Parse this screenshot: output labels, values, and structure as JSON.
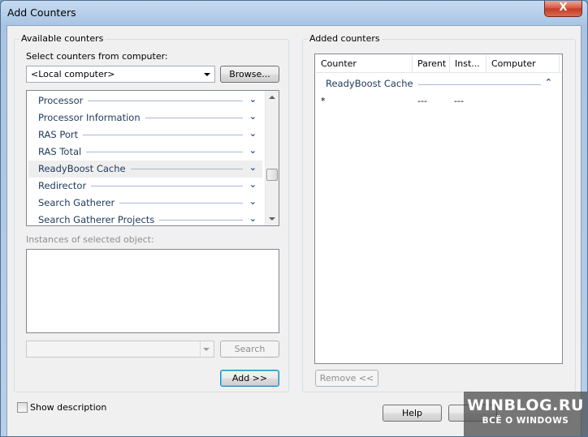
{
  "window": {
    "title": "Add Counters",
    "close_glyph": "X"
  },
  "available": {
    "group_label": "Available counters",
    "select_computer_label": "Select counters from computer:",
    "computer_value": "<Local computer>",
    "browse_label": "Browse...",
    "objects": [
      {
        "label": "Processor",
        "selected": false
      },
      {
        "label": "Processor Information",
        "selected": false
      },
      {
        "label": "RAS Port",
        "selected": false
      },
      {
        "label": "RAS Total",
        "selected": false
      },
      {
        "label": "ReadyBoost Cache",
        "selected": true
      },
      {
        "label": "Redirector",
        "selected": false
      },
      {
        "label": "Search Gatherer",
        "selected": false
      },
      {
        "label": "Search Gatherer Projects",
        "selected": false
      }
    ],
    "instances_label": "Instances of selected object:",
    "search_value": "",
    "search_label": "Search",
    "add_label": "Add >>"
  },
  "added": {
    "group_label": "Added counters",
    "columns": [
      "Counter",
      "Parent",
      "Inst...",
      "Computer"
    ],
    "group_name": "ReadyBoost Cache",
    "rows": [
      {
        "counter": "*",
        "parent": "---",
        "instance": "---",
        "computer": ""
      }
    ],
    "remove_label": "Remove <<"
  },
  "footer": {
    "show_description_label": "Show description",
    "help_label": "Help"
  },
  "watermark": {
    "line1": "WINBLOG.RU",
    "line2": "ВСЁ О WINDOWS"
  },
  "icons": {
    "chevron_down": "⌄",
    "chevron_up": "⌃"
  }
}
